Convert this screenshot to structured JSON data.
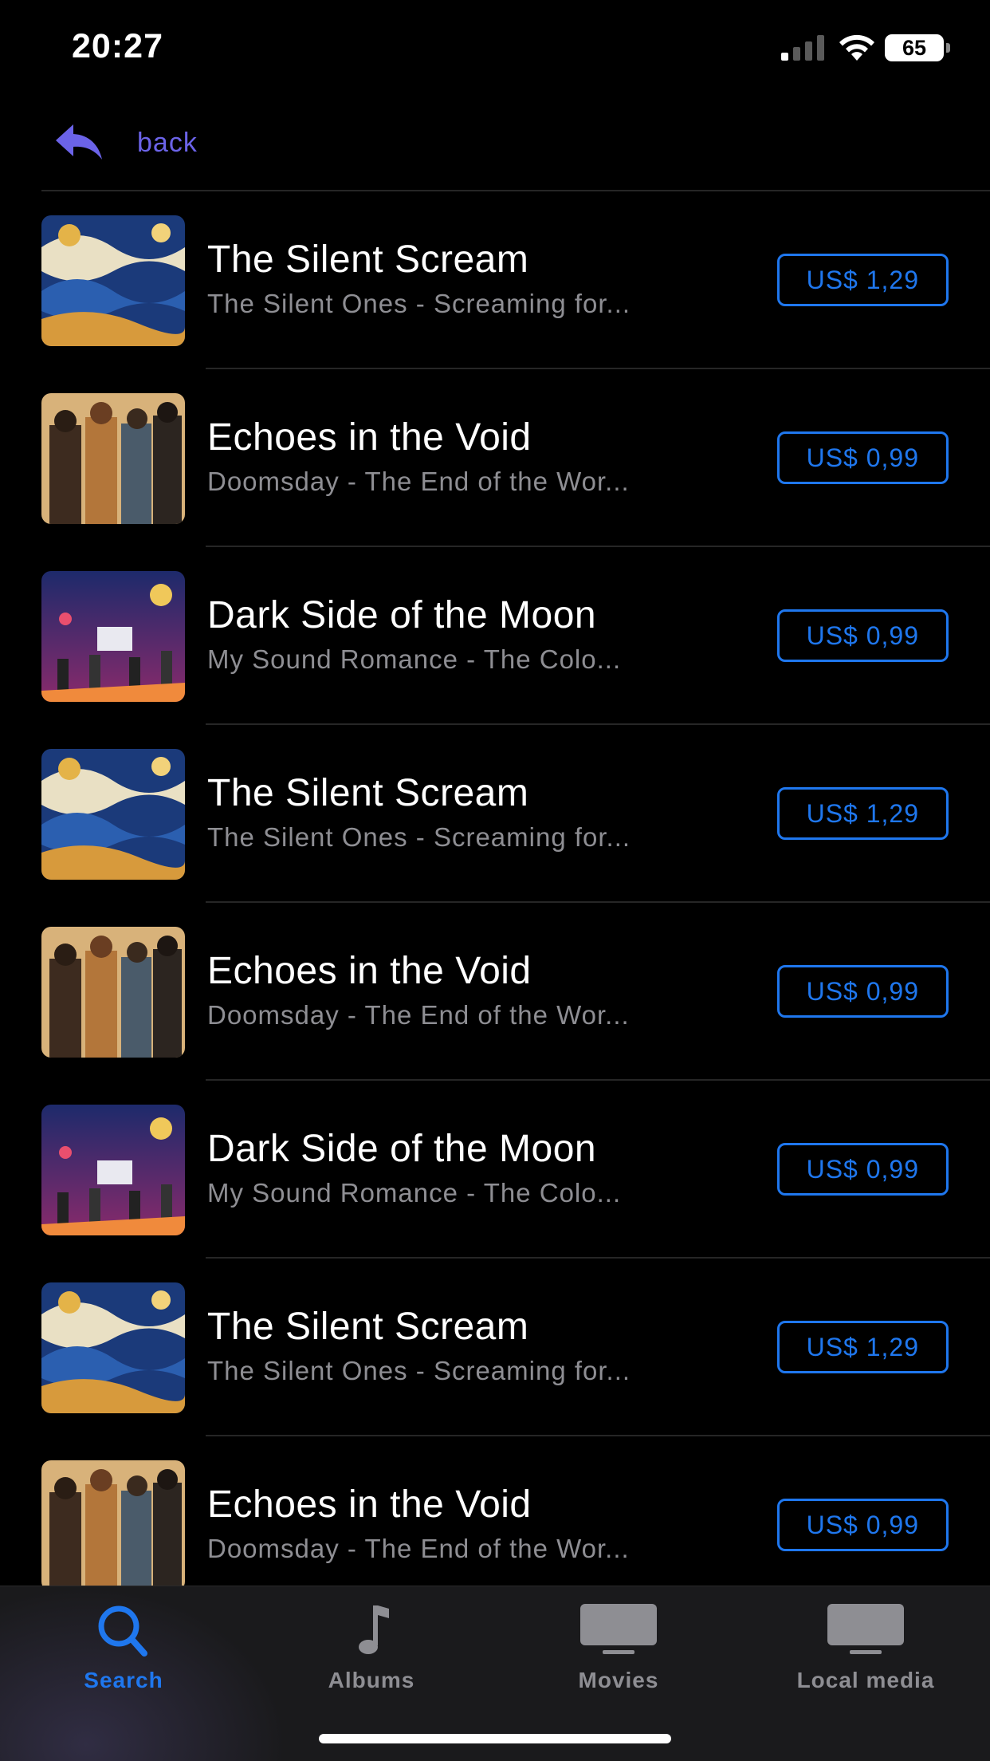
{
  "status_bar": {
    "time": "20:27",
    "battery": "65",
    "icons": [
      "cellular-signal-icon",
      "wifi-icon",
      "battery-icon"
    ]
  },
  "nav": {
    "back_label": "back",
    "back_icon": "back-arrow-icon",
    "accent_color": "#6b63e8"
  },
  "tracks": [
    {
      "title": "The Silent Scream",
      "subtitle": "The Silent Ones - Screaming for...",
      "price": "US$ 1,29"
    },
    {
      "title": "Echoes in the Void",
      "subtitle": "Doomsday - The End of the Wor...",
      "price": "US$ 0,99"
    },
    {
      "title": "Dark Side of the Moon",
      "subtitle": "My Sound Romance - The Colo...",
      "price": "US$ 0,99"
    },
    {
      "title": "The Silent Scream",
      "subtitle": "The Silent Ones - Screaming for...",
      "price": "US$ 1,29"
    },
    {
      "title": "Echoes in the Void",
      "subtitle": "Doomsday - The End of the Wor...",
      "price": "US$ 0,99"
    },
    {
      "title": "Dark Side of the Moon",
      "subtitle": "My Sound Romance - The Colo...",
      "price": "US$ 0,99"
    },
    {
      "title": "The Silent Scream",
      "subtitle": "The Silent Ones - Screaming for...",
      "price": "US$ 1,29"
    },
    {
      "title": "Echoes in the Void",
      "subtitle": "Doomsday - The End of the Wor...",
      "price": "US$ 0,99"
    }
  ],
  "tab_bar": {
    "tabs": [
      {
        "label": "Search",
        "icon": "search-icon",
        "active": true
      },
      {
        "label": "Albums",
        "icon": "music-note-icon",
        "active": false
      },
      {
        "label": "Movies",
        "icon": "tv-icon",
        "active": false
      },
      {
        "label": "Local media",
        "icon": "tv-icon",
        "active": false
      }
    ],
    "active_color": "#1f77ee",
    "inactive_color": "#8e8e93"
  }
}
